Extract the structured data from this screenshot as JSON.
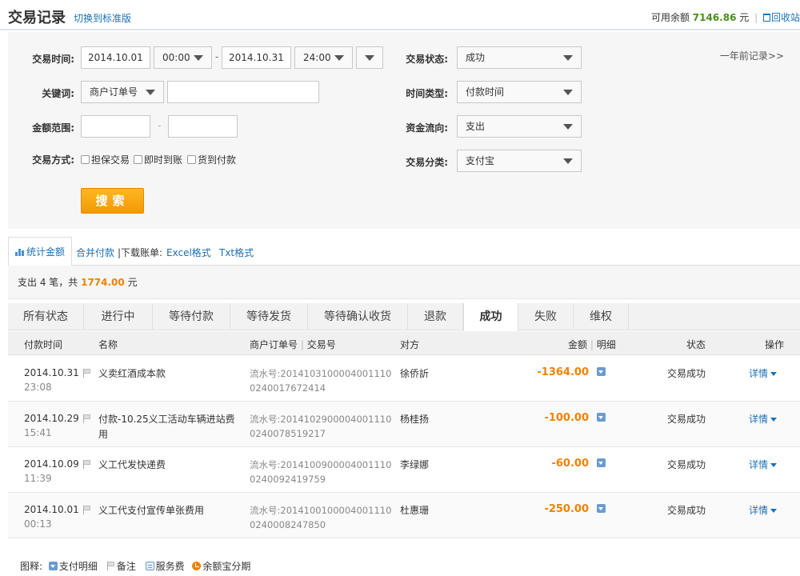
{
  "header": {
    "title": "交易记录",
    "switch_link": "切换到标准版",
    "balance_label": "可用余额",
    "balance_value": "7146.86",
    "balance_unit": "元",
    "separator": "|",
    "recycle_label": "回收站"
  },
  "filters": {
    "time_label": "交易时间:",
    "start_date": "2014.10.01",
    "start_time": "00:00",
    "range_dash": "-",
    "end_date": "2014.10.31",
    "end_time": "24:00",
    "keyword_label": "关键词:",
    "keyword_type": "商户订单号",
    "keyword_value": "",
    "amount_label": "金额范围:",
    "amount_min": "",
    "amount_dash": "-",
    "amount_max": "",
    "method_label": "交易方式:",
    "method_options": [
      "担保交易",
      "即时到账",
      "货到付款"
    ],
    "status_label": "交易状态:",
    "status_value": "成功",
    "time_type_label": "时间类型:",
    "time_type_value": "付款时间",
    "flow_label": "资金流向:",
    "flow_value": "支出",
    "category_label": "交易分类:",
    "category_value": "支付宝",
    "search_button": "搜索",
    "older_link": "一年前记录>>"
  },
  "tools": {
    "stats_tab": "统计金额",
    "merge_pay": "合并付款",
    "download_label": "|下载账单:",
    "excel": "Excel格式",
    "txt": "Txt格式"
  },
  "summary": {
    "prefix": "支出 4 笔，共 ",
    "amount": "1774.00",
    "suffix": " 元"
  },
  "status_tabs": [
    "所有状态",
    "进行中",
    "等待付款",
    "等待发货",
    "等待确认收货",
    "退款",
    "成功",
    "失败",
    "维权"
  ],
  "active_status_tab": "成功",
  "table": {
    "headers": {
      "time": "付款时间",
      "name": "名称",
      "order": "商户订单号",
      "sep": "|",
      "trade_no": "交易号",
      "party": "对方",
      "amount": "金额",
      "detail": "明细",
      "status": "状态",
      "op": "操作"
    },
    "rows": [
      {
        "date": "2014.10.31",
        "time": "23:08",
        "name": "义卖红酒成本款",
        "serial1": "流水号:2014103100004001110",
        "serial2": "0240017672414",
        "party": "徐侨訢",
        "amount": "-1364.00",
        "status": "交易成功",
        "op": "详情"
      },
      {
        "date": "2014.10.29",
        "time": "15:41",
        "name": "付款-10.25义工活动车辆进站费用",
        "serial1": "流水号:2014102900004001110",
        "serial2": "0240078519217",
        "party": "杨桂扬",
        "amount": "-100.00",
        "status": "交易成功",
        "op": "详情"
      },
      {
        "date": "2014.10.09",
        "time": "11:39",
        "name": "义工代发快递费",
        "serial1": "流水号:2014100900004001110",
        "serial2": "0240092419759",
        "party": "李绿娜",
        "amount": "-60.00",
        "status": "交易成功",
        "op": "详情"
      },
      {
        "date": "2014.10.01",
        "time": "00:13",
        "name": "义工代支付宣传单张费用",
        "serial1": "流水号:2014100100004001110",
        "serial2": "0240008247850",
        "party": "杜惠珊",
        "amount": "-250.00",
        "status": "交易成功",
        "op": "详情"
      }
    ]
  },
  "legend": {
    "label": "图释:",
    "pay_detail": "支付明细",
    "note": "备注",
    "service_fee": "服务费",
    "yeb_installment": "余额宝分期"
  },
  "colors": {
    "accent": "#1a6fb5",
    "amount": "#f08200",
    "balance": "#4a8f1e",
    "search_button": "#f5a100"
  }
}
